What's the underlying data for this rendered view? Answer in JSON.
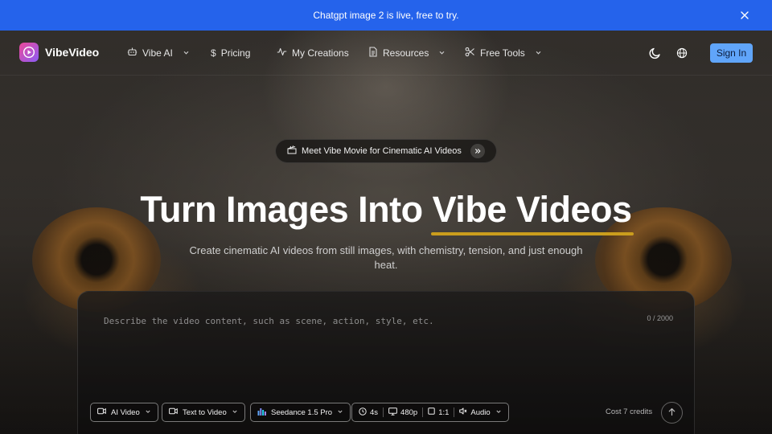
{
  "banner": {
    "text": "Chatgpt image 2 is live, free to try."
  },
  "brand": {
    "name": "VibeVideo"
  },
  "nav": {
    "vibe_ai": "Vibe AI",
    "pricing": "Pricing",
    "my_creations": "My Creations",
    "resources": "Resources",
    "free_tools": "Free Tools",
    "sign_in": "Sign In"
  },
  "promo": {
    "icon": "clapperboard-icon",
    "text": "Meet Vibe Movie for Cinematic AI Videos"
  },
  "hero": {
    "title_part1": "Turn Images Into ",
    "title_highlight": "Vibe Videos",
    "subtitle": "Create cinematic AI videos from still images, with chemistry, tension, and just enough heat."
  },
  "prompt": {
    "placeholder": "Describe the video content, such as scene, action, style, etc.",
    "value": "",
    "counter": "0 / 2000"
  },
  "controls": {
    "mode": "AI Video",
    "type": "Text to Video",
    "model": "Seedance 1.5 Pro",
    "duration": "4s",
    "resolution": "480p",
    "ratio": "1:1",
    "audio": "Audio"
  },
  "cost": "Cost 7 credits",
  "colors": {
    "banner": "#2563eb",
    "sign_in": "#60a5fa",
    "highlight_underline": "#ca9d1d"
  }
}
